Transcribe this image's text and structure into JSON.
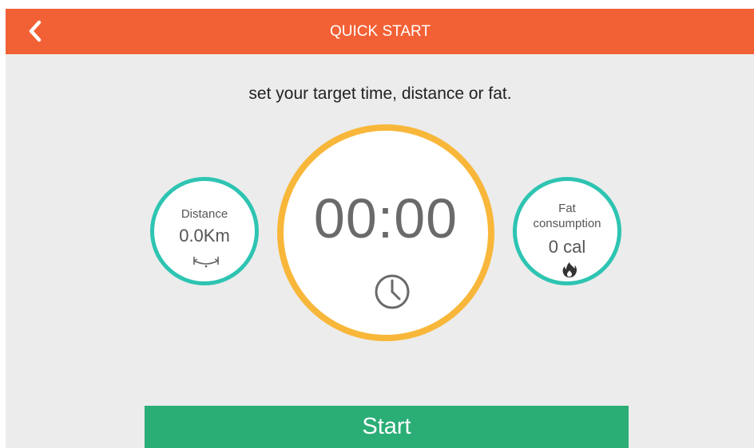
{
  "header": {
    "title": "QUICK START",
    "back_icon": "chevron-left-icon",
    "color": "#f26135"
  },
  "subtitle": "set your target time, distance or fat.",
  "distance": {
    "label": "Distance",
    "value": "0.0Km",
    "icon": "distance-icon",
    "ring_color": "#2ec4b2"
  },
  "time": {
    "value": "00:00",
    "icon": "clock-icon",
    "ring_color": "#f8b73a"
  },
  "fat": {
    "label_line1": "Fat",
    "label_line2": "consumption",
    "value": "0 cal",
    "icon": "flame-icon",
    "ring_color": "#2ec4b2"
  },
  "start_button": {
    "label": "Start",
    "color": "#2bad76"
  }
}
